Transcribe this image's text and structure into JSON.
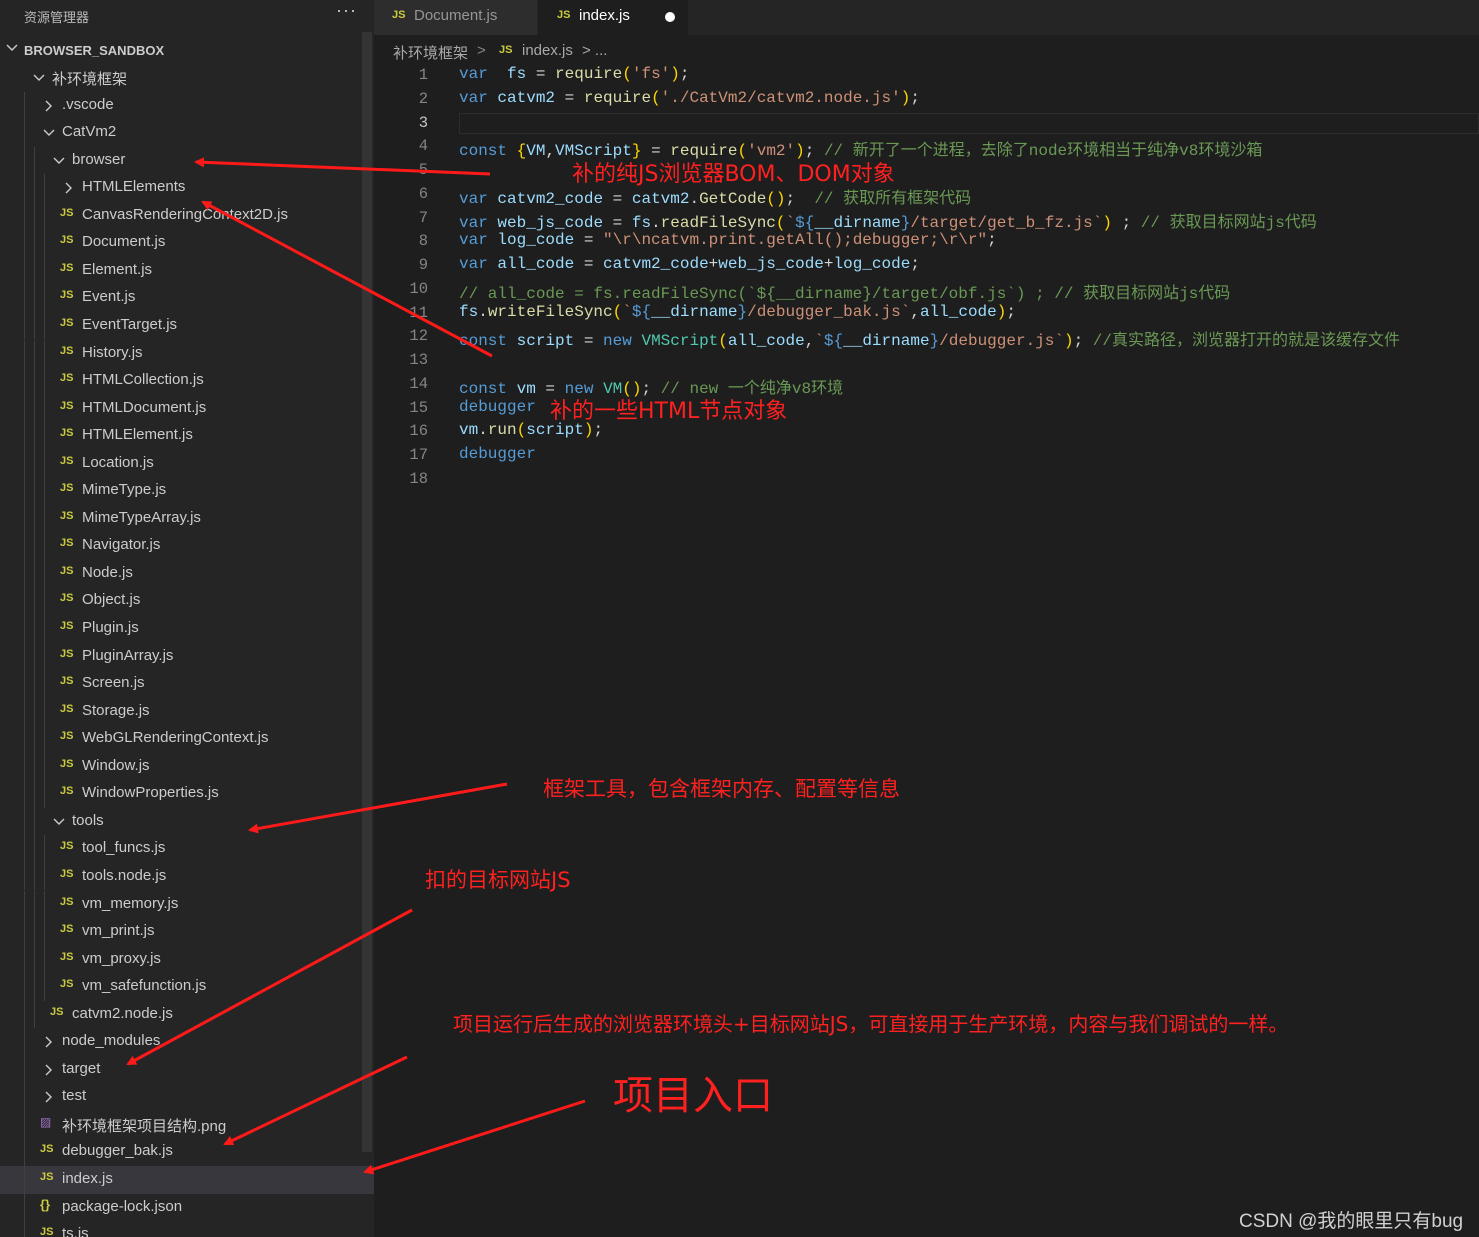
{
  "sidebar": {
    "title": "资源管理器",
    "more": "···",
    "root": "BROWSER_SANDBOX",
    "items": [
      {
        "label": "补环境框架",
        "kind": "folder-open",
        "depth": 1
      },
      {
        "label": ".vscode",
        "kind": "folder",
        "depth": 2
      },
      {
        "label": "CatVm2",
        "kind": "folder-open",
        "depth": 2
      },
      {
        "label": "browser",
        "kind": "folder-open",
        "depth": 3
      },
      {
        "label": "HTMLElements",
        "kind": "folder",
        "depth": 4
      },
      {
        "label": "CanvasRenderingContext2D.js",
        "kind": "js",
        "depth": 4
      },
      {
        "label": "Document.js",
        "kind": "js",
        "depth": 4
      },
      {
        "label": "Element.js",
        "kind": "js",
        "depth": 4
      },
      {
        "label": "Event.js",
        "kind": "js",
        "depth": 4
      },
      {
        "label": "EventTarget.js",
        "kind": "js",
        "depth": 4
      },
      {
        "label": "History.js",
        "kind": "js",
        "depth": 4
      },
      {
        "label": "HTMLCollection.js",
        "kind": "js",
        "depth": 4
      },
      {
        "label": "HTMLDocument.js",
        "kind": "js",
        "depth": 4
      },
      {
        "label": "HTMLElement.js",
        "kind": "js",
        "depth": 4
      },
      {
        "label": "Location.js",
        "kind": "js",
        "depth": 4
      },
      {
        "label": "MimeType.js",
        "kind": "js",
        "depth": 4
      },
      {
        "label": "MimeTypeArray.js",
        "kind": "js",
        "depth": 4
      },
      {
        "label": "Navigator.js",
        "kind": "js",
        "depth": 4
      },
      {
        "label": "Node.js",
        "kind": "js",
        "depth": 4
      },
      {
        "label": "Object.js",
        "kind": "js",
        "depth": 4
      },
      {
        "label": "Plugin.js",
        "kind": "js",
        "depth": 4
      },
      {
        "label": "PluginArray.js",
        "kind": "js",
        "depth": 4
      },
      {
        "label": "Screen.js",
        "kind": "js",
        "depth": 4
      },
      {
        "label": "Storage.js",
        "kind": "js",
        "depth": 4
      },
      {
        "label": "WebGLRenderingContext.js",
        "kind": "js",
        "depth": 4
      },
      {
        "label": "Window.js",
        "kind": "js",
        "depth": 4
      },
      {
        "label": "WindowProperties.js",
        "kind": "js",
        "depth": 4
      },
      {
        "label": "tools",
        "kind": "folder-open",
        "depth": 3
      },
      {
        "label": "tool_funcs.js",
        "kind": "js",
        "depth": 4
      },
      {
        "label": "tools.node.js",
        "kind": "js",
        "depth": 4
      },
      {
        "label": "vm_memory.js",
        "kind": "js",
        "depth": 4
      },
      {
        "label": "vm_print.js",
        "kind": "js",
        "depth": 4
      },
      {
        "label": "vm_proxy.js",
        "kind": "js",
        "depth": 4
      },
      {
        "label": "vm_safefunction.js",
        "kind": "js",
        "depth": 4
      },
      {
        "label": "catvm2.node.js",
        "kind": "js",
        "depth": 3
      },
      {
        "label": "node_modules",
        "kind": "folder",
        "depth": 2
      },
      {
        "label": "target",
        "kind": "folder",
        "depth": 2
      },
      {
        "label": "test",
        "kind": "folder",
        "depth": 2
      },
      {
        "label": "补环境框架项目结构.png",
        "kind": "img",
        "depth": 2
      },
      {
        "label": "debugger_bak.js",
        "kind": "js",
        "depth": 2
      },
      {
        "label": "index.js",
        "kind": "js",
        "depth": 2,
        "selected": true
      },
      {
        "label": "package-lock.json",
        "kind": "json",
        "depth": 2
      },
      {
        "label": "ts.js",
        "kind": "js",
        "depth": 2
      }
    ]
  },
  "tabs": [
    {
      "label": "Document.js",
      "icon": "JS"
    },
    {
      "label": "index.js",
      "icon": "JS",
      "active": true,
      "dirty": true
    }
  ],
  "breadcrumb": {
    "folder": "补环境框架",
    "sep": ">",
    "file_icon": "JS",
    "file": "index.js",
    "tail": "> ..."
  },
  "editor": {
    "line_numbers": [
      "1",
      "2",
      "3",
      "4",
      "5",
      "6",
      "7",
      "8",
      "9",
      "10",
      "11",
      "12",
      "13",
      "14",
      "15",
      "16",
      "17",
      "18"
    ]
  },
  "annotations": {
    "a1": "补的纯JS浏览器BOM、DOM对象",
    "a2": "补的一些HTML节点对象",
    "a3": "框架工具，包含框架内存、配置等信息",
    "a4": "扣的目标网站JS",
    "a5": "项目运行后生成的浏览器环境头+目标网站JS，可直接用于生产环境，内容与我们调试的一样。",
    "a6": "项目入口"
  },
  "watermark": "CSDN @我的眼里只有bug",
  "colors": {
    "annotation": "#ff2020",
    "keyword": "#569cd6",
    "string": "#ce9178",
    "comment": "#6a9955"
  }
}
